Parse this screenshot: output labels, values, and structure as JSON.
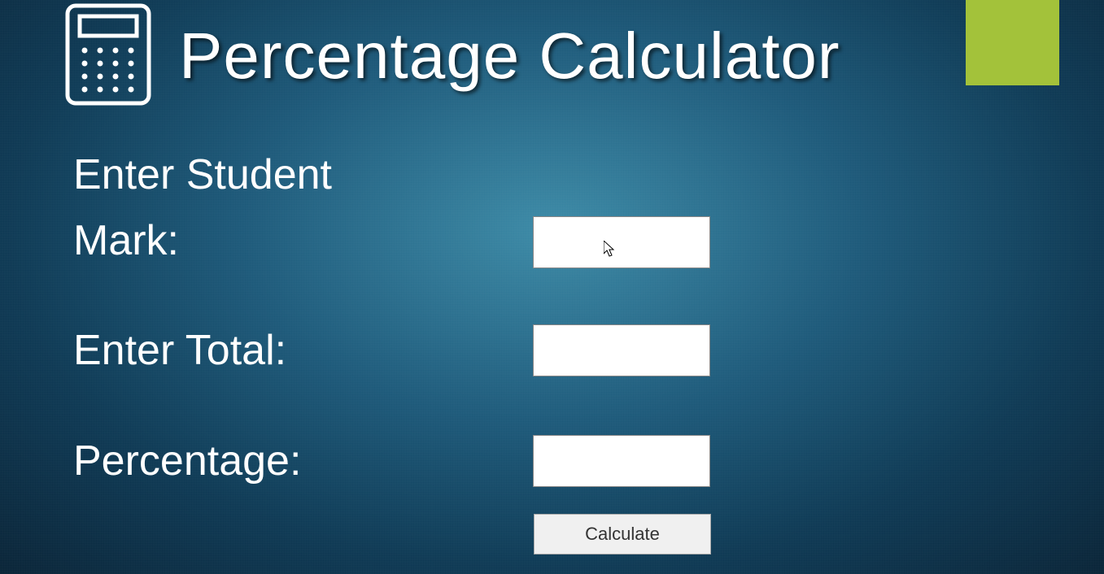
{
  "accent_color": "#a3c23a",
  "title": "Percentage Calculator",
  "form": {
    "student_mark_label": "Enter Student Mark:",
    "student_mark_value": "",
    "total_label": "Enter Total:",
    "total_value": "",
    "percentage_label": "Percentage:",
    "percentage_value": "",
    "calculate_button_label": "Calculate"
  }
}
